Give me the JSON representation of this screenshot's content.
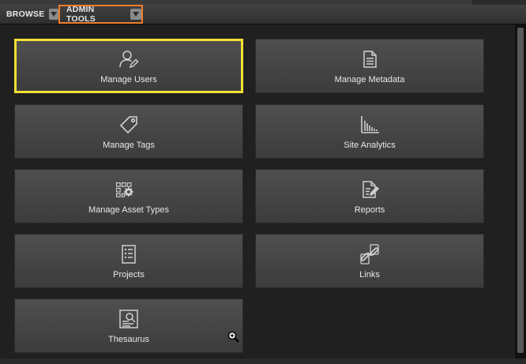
{
  "menubar": {
    "tabs": [
      {
        "label": "BROWSE",
        "icon": "chevron-down-icon"
      },
      {
        "label": "ADMIN TOOLS",
        "icon": "chevron-down-icon",
        "active": true,
        "highlight_color": "#f07f2d"
      }
    ]
  },
  "tiles": [
    {
      "label": "Manage Users",
      "icon": "user-edit-icon",
      "selected": true,
      "selection_color": "#f2e033"
    },
    {
      "label": "Manage Metadata",
      "icon": "document-icon"
    },
    {
      "label": "Manage Tags",
      "icon": "tag-icon"
    },
    {
      "label": "Site Analytics",
      "icon": "analytics-chart-icon"
    },
    {
      "label": "Manage Asset Types",
      "icon": "asset-types-gear-icon"
    },
    {
      "label": "Reports",
      "icon": "report-edit-icon"
    },
    {
      "label": "Projects",
      "icon": "project-list-icon"
    },
    {
      "label": "Links",
      "icon": "link-icon"
    },
    {
      "label": "Thesaurus",
      "icon": "thesaurus-search-icon"
    }
  ]
}
